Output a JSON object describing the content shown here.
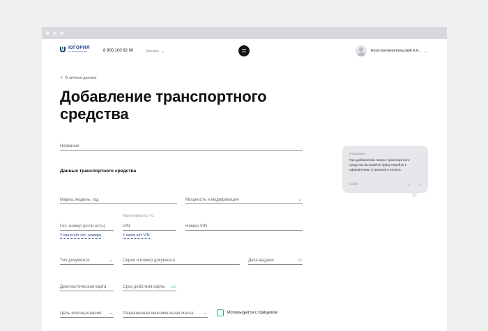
{
  "header": {
    "logo_name": "ЮГОРИЯ",
    "logo_sub": "СТРАХОВАНИЕ",
    "phone": "8 800 100 82 00",
    "city": "Москва",
    "user_name": "Константинопольский К.К."
  },
  "breadcrumb": {
    "back_label": "В личные данные"
  },
  "page": {
    "title": "Добавление транспортного средства"
  },
  "form": {
    "name_label": "Название",
    "section_title": "Данные транспортного средства",
    "brand_label": "Марка, модель, год",
    "power_label": "Мощность и модификация",
    "vin_id_caption": "Идентификатор ТС",
    "plate_label": "Гос. номер (если есть)",
    "vin_short_label": "VIN",
    "vin_number_label": "Номер VIN",
    "no_plate_link": "У меня нет гос. номера",
    "no_vin_link": "У меня нет VIN",
    "doc_type_label": "Тип документа",
    "doc_series_label": "Серия и номер документа",
    "issue_date_label": "Дата выдачи",
    "diag_card_label": "Диагностическая карта",
    "card_validity_label": "Срок действия карты",
    "usage_label": "Цель использования",
    "max_mass_label": "Разрешенная максимальная масса",
    "trailer_label": "Используется с прицепом"
  },
  "tip": {
    "title": "Подсказка",
    "text": "При добавлении нового транспортного средства вы можете сразу  перейти к оформлению Страхового полиса.",
    "counter": "01/05"
  },
  "colors": {
    "accent": "#2aa57f",
    "brand": "#1f3e8a"
  }
}
